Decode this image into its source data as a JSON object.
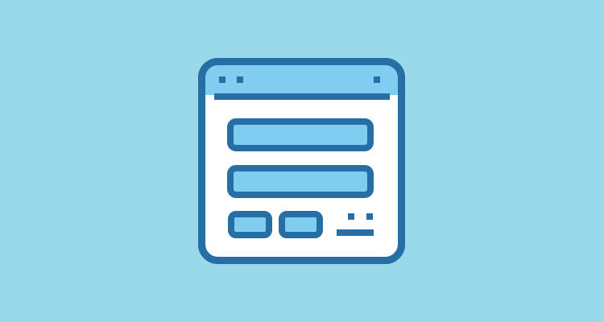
{
  "illustration": {
    "subject": "browser-window-form-icon",
    "colors": {
      "background": "#99d9ea",
      "outline": "#266ea6",
      "fill_light": "#81cdf2",
      "window_body": "#ffffff"
    },
    "icons": {
      "window": "browser-window-icon",
      "title_bar_dots": "window-control-dots-icon",
      "text_field": "text-field-icon",
      "button": "button-icon",
      "link_text": "link-text-icon"
    }
  }
}
